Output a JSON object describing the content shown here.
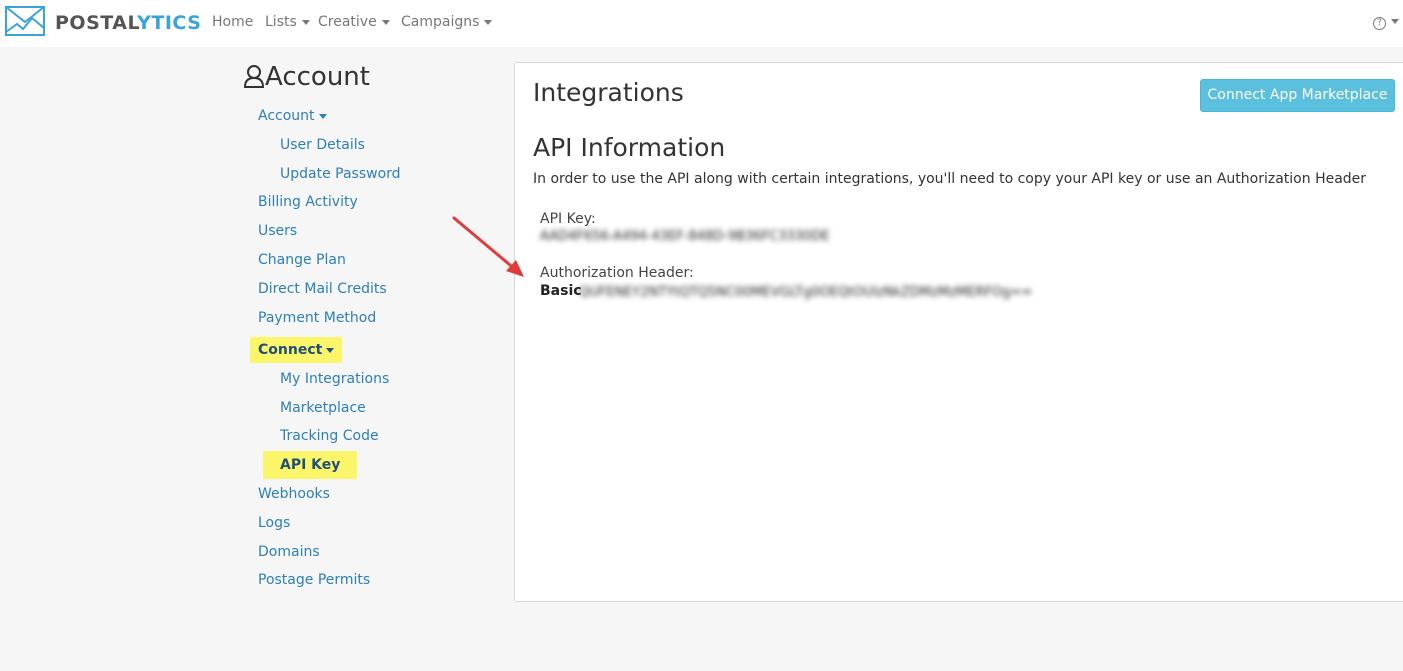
{
  "brand": {
    "name_prefix": "POSTAL",
    "name_suffix": "YTICS",
    "accent_color": "#3aa3d8"
  },
  "topnav": {
    "home": "Home",
    "lists": "Lists",
    "creative": "Creative",
    "campaigns": "Campaigns",
    "help_icon": "question-circle-icon"
  },
  "sidebar": {
    "heading": "Account",
    "account": "Account",
    "user_details": "User Details",
    "update_password": "Update Password",
    "billing_activity": "Billing Activity",
    "users": "Users",
    "change_plan": "Change Plan",
    "direct_mail_credits": "Direct Mail Credits",
    "payment_method": "Payment Method",
    "connect": "Connect",
    "my_integrations": "My Integrations",
    "marketplace": "Marketplace",
    "tracking_code": "Tracking Code",
    "api_key": "API Key",
    "webhooks": "Webhooks",
    "logs": "Logs",
    "domains": "Domains",
    "postage_permits": "Postage Permits",
    "highlight_color": "#fbf56a"
  },
  "main": {
    "title": "Integrations",
    "connect_button": "Connect App Marketplace",
    "api_title": "API Information",
    "api_description": "In order to use the API along with certain integrations, you'll need to copy your API key or use an Authorization Header",
    "api_key_label": "API Key:",
    "api_key_value": "AAD4F656-A494-43EF-848D-9B36FC3330DE",
    "auth_header_label": "Authorization Header:",
    "auth_basic_label": "Basic",
    "auth_header_value": "QUFENEY2NTYtQTQ5NC00MEVGLTg0OEQtOUIzNkZDMzMzMERFOg=="
  }
}
